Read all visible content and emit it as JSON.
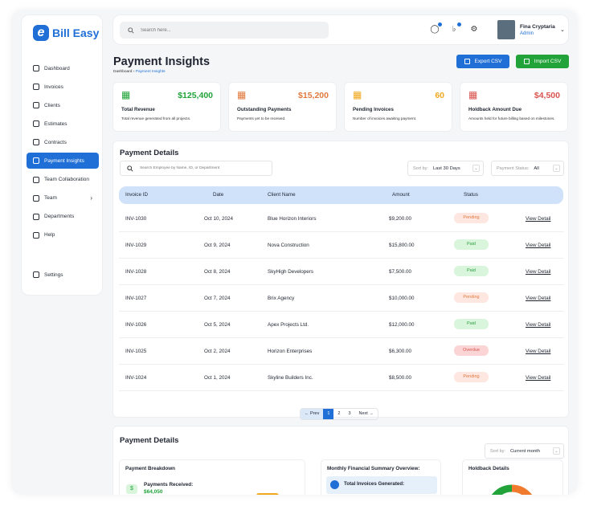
{
  "brand": {
    "logo_letter": "e",
    "name": "Bill Easy",
    "color": "#1f6fd6"
  },
  "sidebar": {
    "items": [
      {
        "label": "Dashboard",
        "icon": "dashboard-icon"
      },
      {
        "label": "Invoices",
        "icon": "invoice-icon"
      },
      {
        "label": "Clients",
        "icon": "clients-icon"
      },
      {
        "label": "Estimates",
        "icon": "estimates-icon"
      },
      {
        "label": "Contracts",
        "icon": "contracts-icon"
      },
      {
        "label": "Payment Insights",
        "icon": "payment-insights-icon",
        "active": true
      },
      {
        "label": "Team Collaboration",
        "icon": "team-collaboration-icon"
      },
      {
        "label": "Team",
        "icon": "team-icon",
        "has_submenu": true
      },
      {
        "label": "Departments",
        "icon": "departments-icon"
      },
      {
        "label": "Help",
        "icon": "help-icon"
      }
    ],
    "settings_label": "Settings"
  },
  "topbar": {
    "search_placeholder": "Search here...",
    "user": {
      "name": "Fina Cryptaria",
      "role": "Admin"
    }
  },
  "header": {
    "title": "Payment Insights",
    "breadcrumb": [
      "Dashboard",
      "Payment Insights"
    ],
    "export_label": "Export CSV",
    "import_label": "Import CSV"
  },
  "stats": [
    {
      "title": "Total Revenue",
      "value": "$125,400",
      "desc": "Total revenue generated from all projects.",
      "color": "#22a33a",
      "icon": "revenue-icon"
    },
    {
      "title": "Outstanding Payments",
      "value": "$15,200",
      "desc": "Payments yet to be received.",
      "color": "#e07a3f",
      "icon": "outstanding-icon"
    },
    {
      "title": "Pending Invoices",
      "value": "60",
      "desc": "Number of invoices awaiting payment.",
      "color": "#f0a81e",
      "icon": "pending-icon"
    },
    {
      "title": "Holdback Amount Due",
      "value": "$4,500",
      "desc": "Amounts held for future billing based on milestones.",
      "color": "#d9534f",
      "icon": "holdback-icon"
    }
  ],
  "details": {
    "title": "Payment Details",
    "search_placeholder": "Search Employee by Name, ID, or Department",
    "sort_label": "Sort by:",
    "sort_value": "Last 30 Days",
    "status_label": "Payment Status:",
    "status_value": "All",
    "columns": [
      "Invoice ID",
      "Date",
      "Client Name",
      "Amount",
      "Status"
    ],
    "rows": [
      {
        "id": "INV-1030",
        "date": "Oct 10, 2024",
        "client": "Blue Horizon Interiors",
        "amount": "$9,200.00",
        "status": "Pending",
        "kind": "pending",
        "action": "View Detail"
      },
      {
        "id": "INV-1029",
        "date": "Oct 9, 2024",
        "client": "Nova Construction",
        "amount": "$15,800.00",
        "status": "Paid",
        "kind": "paid",
        "action": "View Detail"
      },
      {
        "id": "INV-1028",
        "date": "Oct 8, 2024",
        "client": "SkyHigh Developers",
        "amount": "$7,500.00",
        "status": "Paid",
        "kind": "paid",
        "action": "View Detail"
      },
      {
        "id": "INV-1027",
        "date": "Oct 7, 2024",
        "client": "Brix Agency",
        "amount": "$10,000.00",
        "status": "Pending",
        "kind": "pending",
        "action": "View Detail"
      },
      {
        "id": "INV-1026",
        "date": "Oct 5, 2024",
        "client": "Apex Projects Ltd.",
        "amount": "$12,000.00",
        "status": "Paid",
        "kind": "paid",
        "action": "View Detail"
      },
      {
        "id": "INV-1025",
        "date": "Oct 2, 2024",
        "client": "Horizon Enterprises",
        "amount": "$6,300.00",
        "status": "Overdue",
        "kind": "overdue",
        "action": "View Detail"
      },
      {
        "id": "INV-1024",
        "date": "Oct 1, 2024",
        "client": "Skyline Builders Inc.",
        "amount": "$8,500.00",
        "status": "Pending",
        "kind": "pending",
        "action": "View Detail"
      }
    ],
    "pagination": {
      "prev": "Prev",
      "pages": [
        "1",
        "2",
        "3"
      ],
      "current": "1",
      "next": "Next"
    }
  },
  "summary": {
    "title": "Payment Details",
    "sort_label": "Sort by:",
    "sort_value": "Current month",
    "breakdown_title": "Payment Breakdown",
    "payments_received_label": "Payments Received:",
    "payments_received_value": "$64,050",
    "monthly_title": "Monthly Financial Summary Overview:",
    "total_invoices_label": "Total Invoices Generated:",
    "holdback_title": "Holdback Details"
  }
}
